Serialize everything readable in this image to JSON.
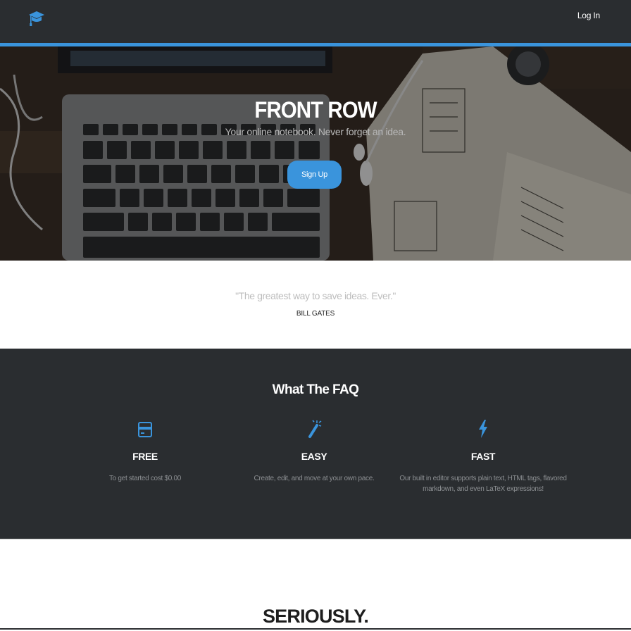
{
  "colors": {
    "accent": "#3a94dc",
    "dark": "#2a2d30"
  },
  "nav": {
    "login_label": "Log In",
    "logo_icon": "graduation-cap-icon"
  },
  "hero": {
    "title": "FRONT ROW",
    "subtitle": "Your online notebook. Never forget an idea.",
    "signup_label": "Sign Up"
  },
  "quote": {
    "text": "\"The greatest way to save ideas. Ever.\"",
    "author": "BILL GATES"
  },
  "faq": {
    "title": "What The FAQ",
    "features": [
      {
        "icon": "credit-card-icon",
        "title": "FREE",
        "description": "To get started cost $0.00"
      },
      {
        "icon": "magic-wand-icon",
        "title": "EASY",
        "description": "Create, edit, and move at your own pace."
      },
      {
        "icon": "lightning-bolt-icon",
        "title": "FAST",
        "description": "Our built in editor supports plain text, HTML tags, flavored markdown, and even LaTeX expressions!"
      }
    ]
  },
  "seriously": {
    "heading": "SERIOUSLY."
  }
}
